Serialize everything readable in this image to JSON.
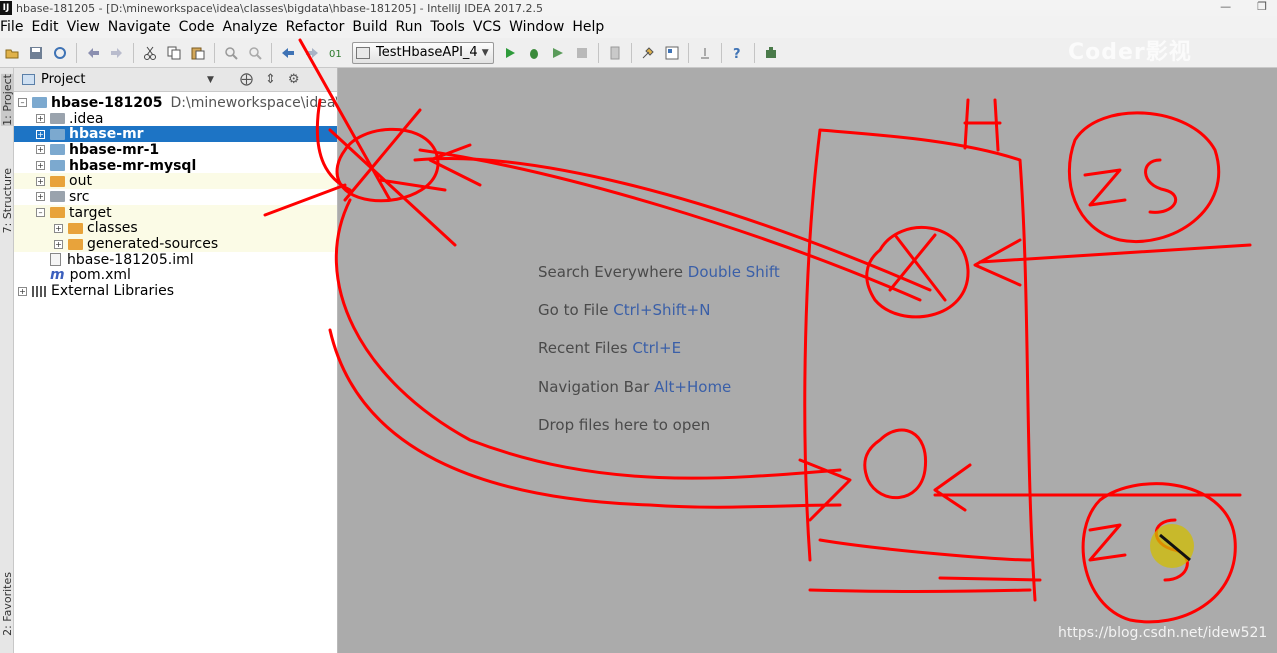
{
  "window": {
    "title": "hbase-181205 - [D:\\mineworkspace\\idea\\classes\\bigdata\\hbase-181205] - IntelliJ IDEA 2017.2.5"
  },
  "menu": [
    "File",
    "Edit",
    "View",
    "Navigate",
    "Code",
    "Analyze",
    "Refactor",
    "Build",
    "Run",
    "Tools",
    "VCS",
    "Window",
    "Help"
  ],
  "toolbar": {
    "run_config": "TestHbaseAPI_4"
  },
  "side_tabs": {
    "project": "1: Project",
    "structure": "7: Structure",
    "favorites": "2: Favorites"
  },
  "project_panel": {
    "title": "Project",
    "tree": [
      {
        "label": "hbase-181205",
        "path": "D:\\mineworkspace\\idea\\cla",
        "bold": true,
        "icon": "module-folder"
      },
      {
        "label": ".idea",
        "icon": "grey-folder"
      },
      {
        "label": "hbase-mr",
        "bold": true,
        "icon": "module-folder",
        "selected": true
      },
      {
        "label": "hbase-mr-1",
        "bold": true,
        "icon": "module-folder"
      },
      {
        "label": "hbase-mr-mysql",
        "bold": true,
        "icon": "module-folder"
      },
      {
        "label": "out",
        "icon": "orange-folder"
      },
      {
        "label": "src",
        "icon": "grey-folder"
      },
      {
        "label": "target",
        "icon": "orange-folder"
      },
      {
        "label": "classes",
        "icon": "orange-folder"
      },
      {
        "label": "generated-sources",
        "icon": "orange-folder"
      },
      {
        "label": "hbase-181205.iml",
        "icon": "iml-file"
      },
      {
        "label": "pom.xml",
        "icon": "maven-file"
      },
      {
        "label": "External Libraries",
        "icon": "library"
      }
    ]
  },
  "editor_hints": [
    {
      "text": "Search Everywhere",
      "key": "Double Shift"
    },
    {
      "text": "Go to File",
      "key": "Ctrl+Shift+N"
    },
    {
      "text": "Recent Files",
      "key": "Ctrl+E"
    },
    {
      "text": "Navigation Bar",
      "key": "Alt+Home"
    },
    {
      "text": "Drop files here to open",
      "key": ""
    }
  ],
  "annotations": {
    "label_h": "H",
    "label_zs_top": "ZS",
    "label_zs_bottom": "ZS"
  },
  "watermark": {
    "brand": "Coder影视",
    "url": "https://blog.csdn.net/idew521"
  },
  "colors": {
    "selection": "#1d74c5",
    "scribble": "#ff0000",
    "editor_bg": "#ababab"
  }
}
